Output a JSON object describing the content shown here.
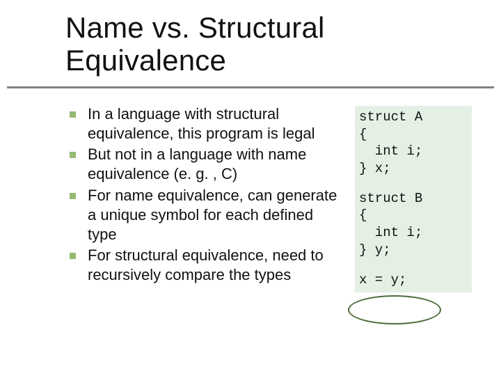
{
  "title_line1": "Name vs. Structural",
  "title_line2": "Equivalence",
  "bullets": [
    "In a language with structural equivalence, this program is legal",
    "But not in a language with name equivalence (e. g. , C)",
    "For name equivalence, can generate a unique symbol for each defined type",
    "For structural equivalence, need to recursively compare the types"
  ],
  "code": {
    "block1": "struct A\n{\n  int i;\n} x;",
    "block2": "struct B\n{\n  int i;\n} y;",
    "block3": "x = y;"
  }
}
